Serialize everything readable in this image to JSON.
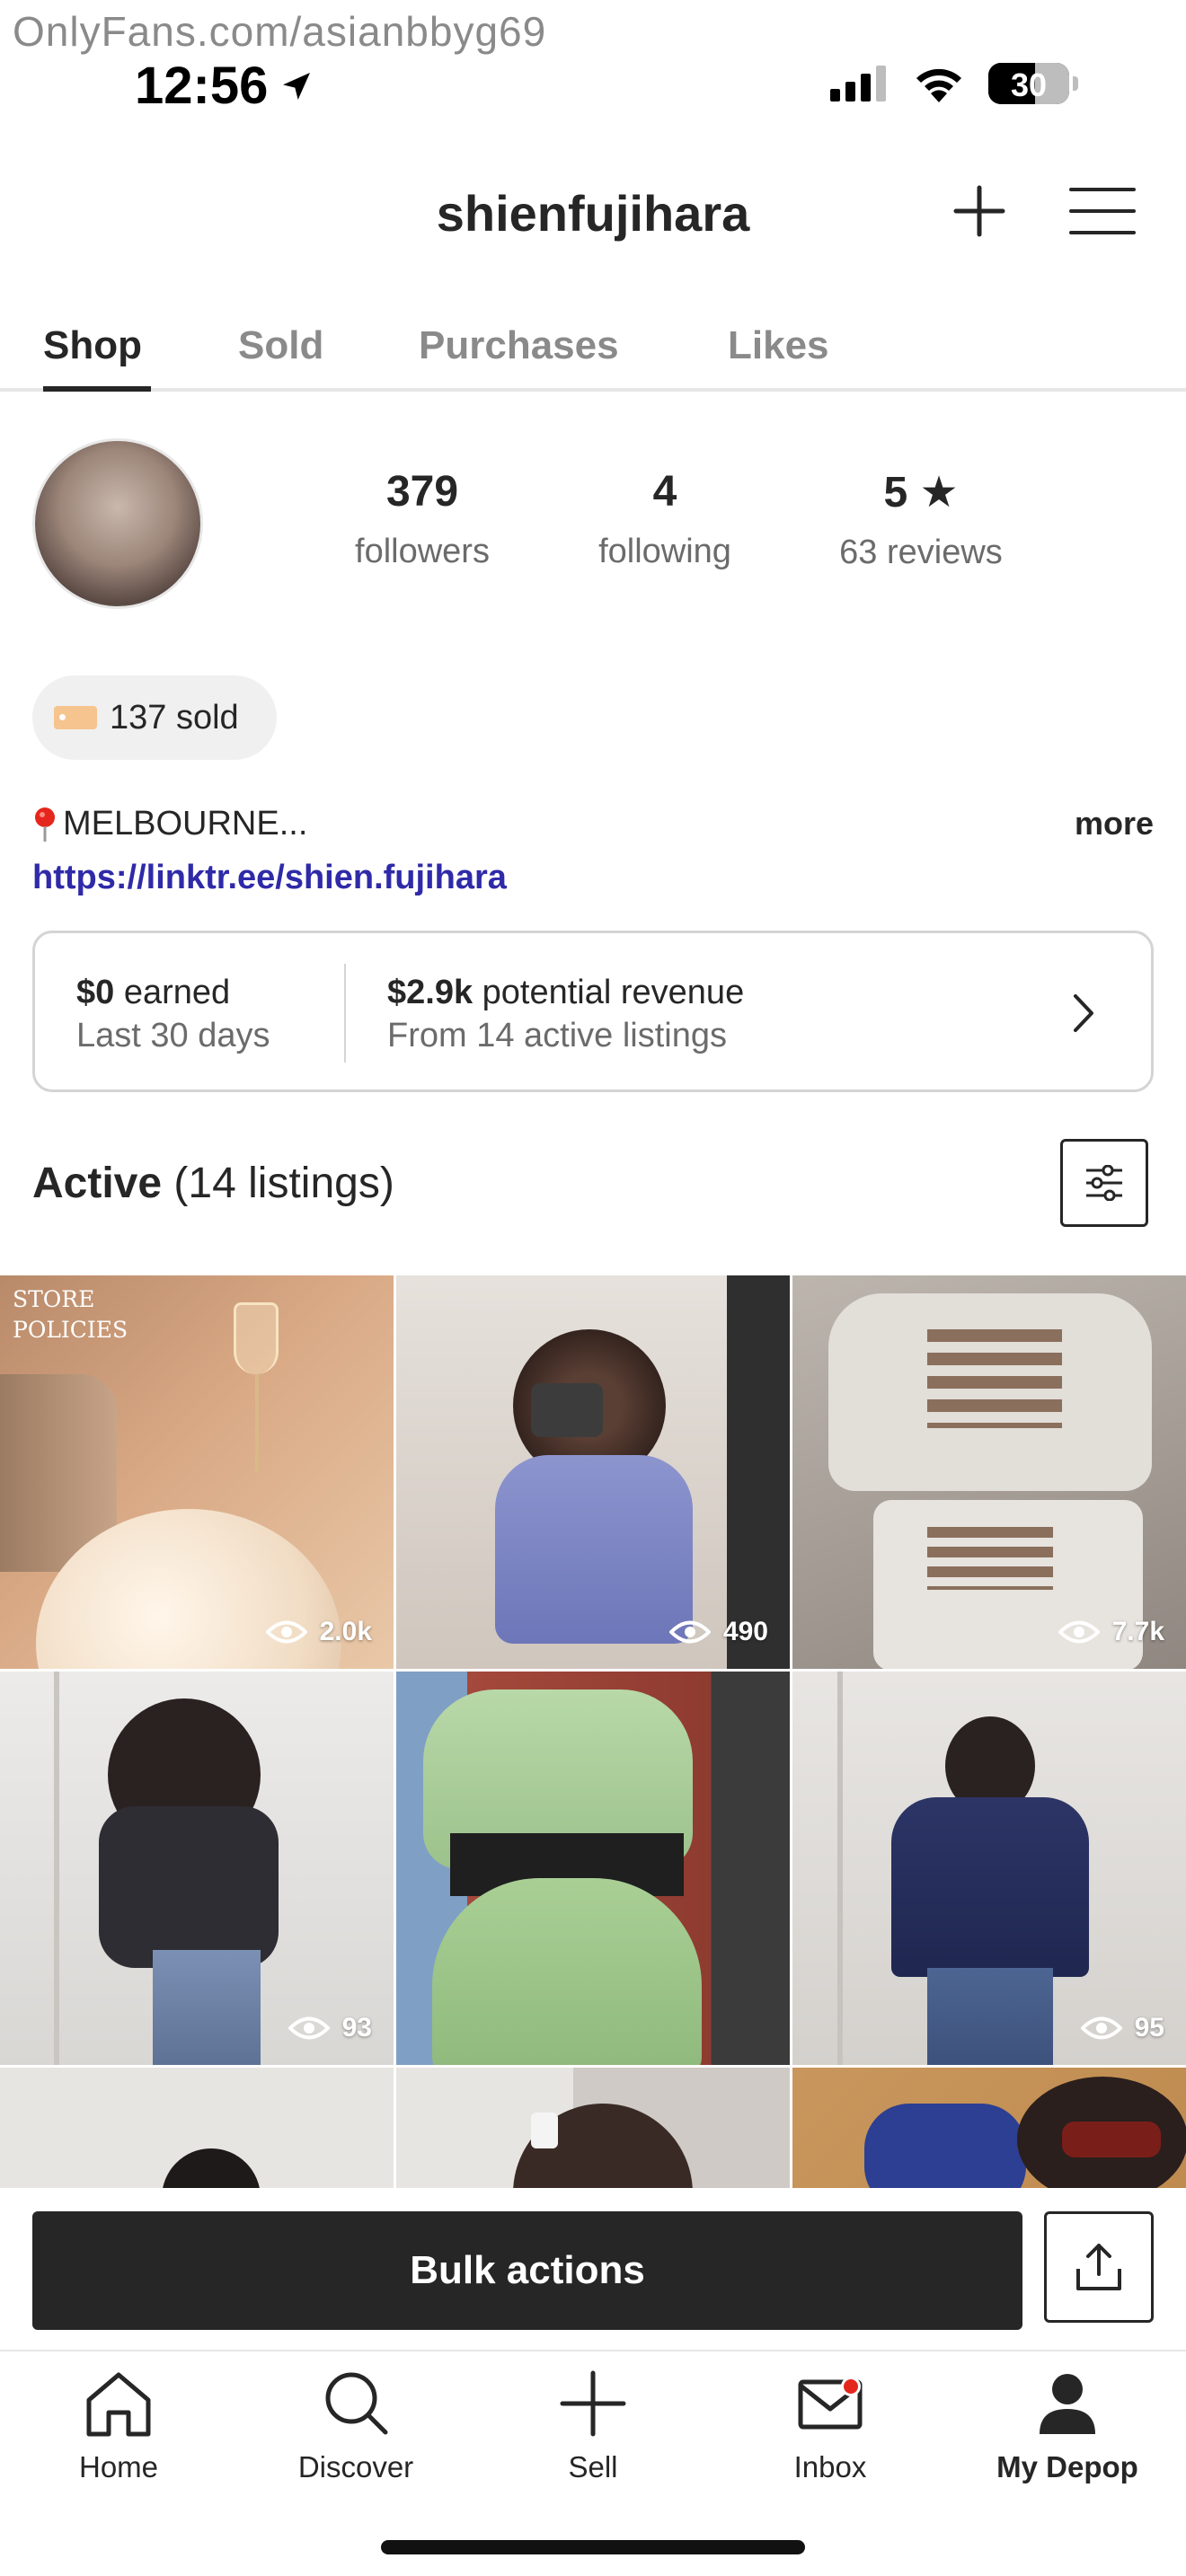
{
  "watermark": "OnlyFans.com/asianbbyg69",
  "status_bar": {
    "time": "12:56",
    "battery": "30",
    "icons": [
      "location-arrow-icon",
      "signal-icon",
      "wifi-icon",
      "battery-icon"
    ]
  },
  "header": {
    "username": "shienfujihara",
    "icons": [
      "plus-icon",
      "hamburger-menu-icon"
    ]
  },
  "tabs": [
    {
      "label": "Shop",
      "active": true
    },
    {
      "label": "Sold",
      "active": false
    },
    {
      "label": "Purchases",
      "active": false
    },
    {
      "label": "Likes",
      "active": false
    }
  ],
  "profile": {
    "stats": [
      {
        "value": "379",
        "label": "followers"
      },
      {
        "value": "4",
        "label": "following"
      },
      {
        "value": "5 ★",
        "label": "63 reviews"
      }
    ],
    "sold_badge": "137 sold",
    "location": "MELBOURNE...",
    "more": "more",
    "link": "https://linktr.ee/shien.fujihara"
  },
  "earnings": {
    "earned_value": "$0",
    "earned_label": " earned",
    "earned_sub": "Last 30 days",
    "revenue_value": "$2.9k",
    "revenue_label": " potential revenue",
    "revenue_sub": "From 14 active listings"
  },
  "active": {
    "title": "Active",
    "count": " (14 listings)"
  },
  "listings": [
    {
      "views": "2.0k",
      "label": "STORE\nPOLICIES"
    },
    {
      "views": "490"
    },
    {
      "views": "7.7k"
    },
    {
      "views": "93"
    },
    {
      "views": ""
    },
    {
      "views": "95"
    }
  ],
  "actions": {
    "bulk": "Bulk actions"
  },
  "bottom_nav": [
    {
      "label": "Home",
      "icon": "home-icon",
      "active": false
    },
    {
      "label": "Discover",
      "icon": "search-icon",
      "active": false
    },
    {
      "label": "Sell",
      "icon": "plus-icon",
      "active": false
    },
    {
      "label": "Inbox",
      "icon": "mail-icon",
      "active": false,
      "badge": true
    },
    {
      "label": "My Depop",
      "icon": "profile-icon",
      "active": true
    }
  ],
  "colors": {
    "link": "#2f2aa8",
    "primary": "#262626",
    "muted": "#6b6b6b",
    "notification": "#e5261c"
  }
}
